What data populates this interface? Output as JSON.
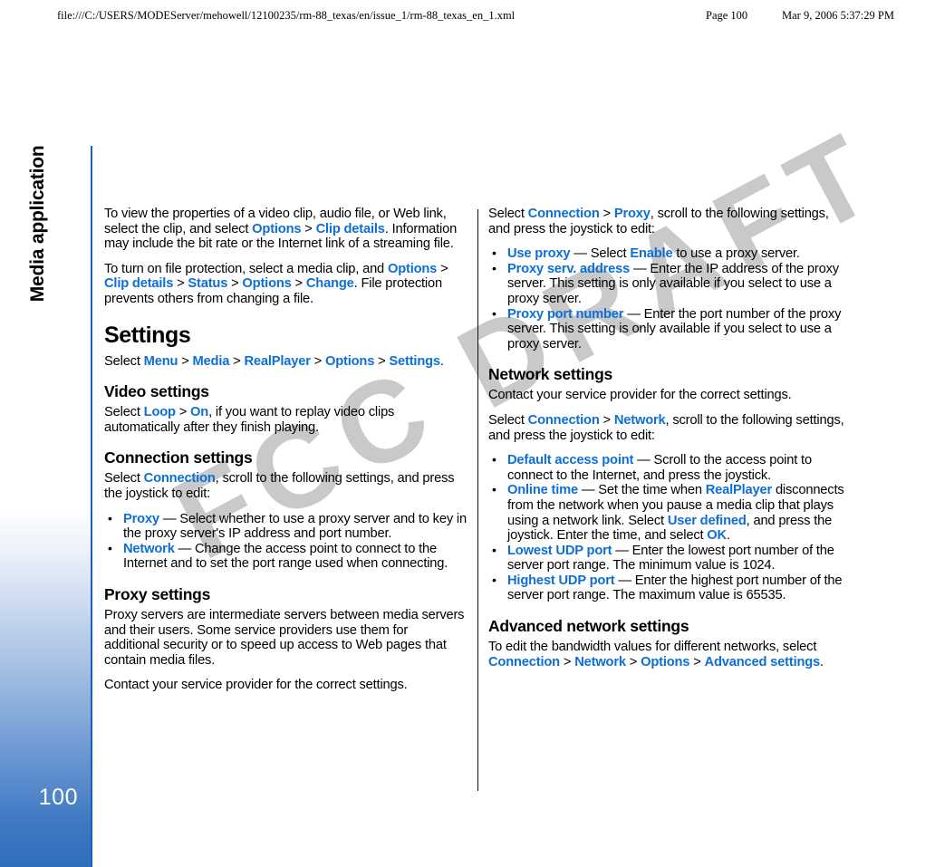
{
  "print_header": {
    "url": "file:///C:/USERS/MODEServer/mehowell/12100235/rm-88_texas/en/issue_1/rm-88_texas_en_1.xml",
    "page": "Page 100",
    "date": "Mar 9, 2006 5:37:29 PM"
  },
  "side_tab": {
    "label": "Media applications",
    "page_number": "100"
  },
  "watermark": {
    "text": "FCC DRAFT",
    "color": "#c9c9c9"
  },
  "theme": {
    "keyword_color": "#0d6fd6",
    "tab_blue": "#2f6ebd",
    "tab_border": "#1763b0"
  },
  "left_column": {
    "paragraph_1": {
      "t1": "To view the properties of a video clip, audio file, or Web link, select the clip, and select ",
      "k1": "Options",
      "s1": " > ",
      "k2": "Clip details",
      "t2": ". Information may include the bit rate or the Internet link of a streaming file."
    },
    "paragraph_2": {
      "t1": "To turn on file protection, select a media clip, and ",
      "k1": "Options",
      "s1": " > ",
      "k2": "Clip details",
      "s2": " > ",
      "k3": "Status",
      "s3": " > ",
      "k4": "Options",
      "s4": " > ",
      "k5": "Change",
      "t2": ". File protection prevents others from changing a file."
    },
    "settings_heading": "Settings",
    "settings_path": {
      "t1": "Select ",
      "k1": "Menu",
      "s1": " > ",
      "k2": "Media",
      "s2": " > ",
      "k3": "RealPlayer",
      "s3": " > ",
      "k4": "Options",
      "s4": " > ",
      "k5": "Settings",
      "t2": "."
    },
    "video_settings_heading": "Video settings",
    "video_settings_body": {
      "t1": "Select ",
      "k1": "Loop",
      "s1": " > ",
      "k2": "On",
      "t2": ", if you want to replay video clips automatically after they finish playing."
    },
    "connection_settings_heading": "Connection settings",
    "connection_settings_intro": {
      "t1": "Select ",
      "k1": "Connection",
      "t2": ", scroll to the following settings, and press the joystick to edit:"
    },
    "connection_bullets": [
      {
        "keyword": "Proxy",
        "text": " — Select whether to use a proxy server and to key in the proxy server's IP address and port number."
      },
      {
        "keyword": "Network",
        "text": " — Change the access point to connect to the Internet and to set the port range used when connecting."
      }
    ],
    "proxy_settings_heading": "Proxy settings",
    "proxy_settings_body_1": "Proxy servers are intermediate servers between media servers and their users. Some service providers use them for additional security or to speed up access to Web pages that contain media files.",
    "proxy_settings_body_2": "Contact your service provider for the correct settings."
  },
  "right_column": {
    "proxy_intro": {
      "t1": "Select ",
      "k1": "Connection",
      "s1": " > ",
      "k2": "Proxy",
      "t2": ", scroll to the following settings, and press the joystick to edit:"
    },
    "proxy_bullets": [
      {
        "keyword": "Use proxy",
        "text_before": " — Select ",
        "keyword2": "Enable",
        "text_after": " to use a proxy server."
      },
      {
        "keyword": "Proxy serv. address",
        "text_before": " — Enter the IP address of the proxy server. This setting is only available if you select to use a proxy server.",
        "keyword2": "",
        "text_after": ""
      },
      {
        "keyword": "Proxy port number",
        "text_before": " — Enter the port number of the proxy server. This setting is only available if you select to use a proxy server.",
        "keyword2": "",
        "text_after": ""
      }
    ],
    "network_settings_heading": "Network settings",
    "network_settings_contact": "Contact your service provider for the correct settings.",
    "network_settings_intro": {
      "t1": "Select ",
      "k1": "Connection",
      "s1": " > ",
      "k2": "Network",
      "t2": ", scroll to the following settings, and press the joystick to edit:"
    },
    "network_bullets": [
      {
        "keyword": "Default access point",
        "text": " — Scroll to the access point to connect to the Internet, and press the joystick."
      },
      {
        "keyword": "Online time",
        "text": " — Set the time when RealPlayer disconnects from the network when you pause a media clip that plays using a network link. Select User defined, and press the joystick. Enter the time, and select OK."
      },
      {
        "keyword": "Lowest UDP port",
        "text": " — Enter the lowest port number of the server port range. The minimum value is 1024."
      },
      {
        "keyword": "Highest UDP port",
        "text": " — Enter the highest port number of the server port range. The maximum value is 65535."
      }
    ],
    "online_time_parts": {
      "k_realplayer": "RealPlayer",
      "k_userdefined": "User defined",
      "k_ok": "OK",
      "p1": " — Set the time when ",
      "p2": " disconnects from the network when you pause a media clip that plays using a network link. Select ",
      "p3": ", and press the joystick. Enter the time, and select ",
      "p4": "."
    },
    "advanced_heading": "Advanced network settings",
    "advanced_body": {
      "t1": "To edit the bandwidth values for different networks, select ",
      "k1": "Connection",
      "s1": " > ",
      "k2": "Network",
      "s2": " > ",
      "k3": "Options",
      "s3": " > ",
      "k4": "Advanced settings",
      "t2": "."
    }
  }
}
